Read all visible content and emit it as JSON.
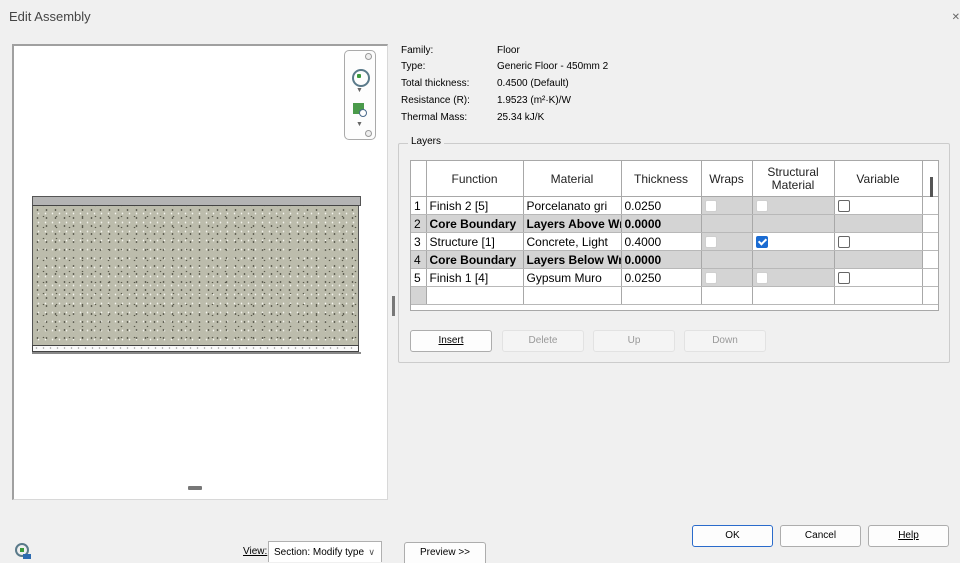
{
  "window": {
    "title": "Edit Assembly"
  },
  "properties": [
    {
      "label": "Family:",
      "value": "Floor"
    },
    {
      "label": "Type:",
      "value": "Generic Floor - 450mm 2"
    },
    {
      "label": "Total thickness:",
      "value": "0.4500 (Default)"
    },
    {
      "label": "Resistance (R):",
      "value": "1.9523 (m²·K)/W"
    },
    {
      "label": "Thermal Mass:",
      "value": "25.34 kJ/K"
    }
  ],
  "layers": {
    "legend": "Layers",
    "columns": [
      "",
      "Function",
      "Material",
      "Thickness",
      "Wraps",
      "Structural Material",
      "Variable"
    ],
    "rows": [
      {
        "num": "1",
        "function": "Finish 2 [5]",
        "material": "Porcelanato gri",
        "thickness": "0.0250",
        "wraps": false,
        "structural": false,
        "variable": false
      },
      {
        "num": "2",
        "function": "Core Boundary",
        "material": "Layers Above Wr",
        "thickness": "0.0000"
      },
      {
        "num": "3",
        "function": "Structure [1]",
        "material": "Concrete, Light",
        "thickness": "0.4000",
        "wraps": false,
        "structural": true,
        "variable": false
      },
      {
        "num": "4",
        "function": "Core Boundary",
        "material": "Layers Below Wr",
        "thickness": "0.0000"
      },
      {
        "num": "5",
        "function": "Finish 1 [4]",
        "material": "Gypsum Muro",
        "thickness": "0.0250",
        "wraps": false,
        "structural": false,
        "variable": false
      }
    ]
  },
  "buttons": {
    "insert": "Insert",
    "delete": "Delete",
    "up": "Up",
    "down": "Down",
    "ok": "OK",
    "cancel": "Cancel",
    "help": "Help",
    "preview": "Preview >>"
  },
  "view": {
    "label": "View:",
    "value": "Section: Modify type"
  },
  "icons": [
    "steering-wheel-icon",
    "zoom-icon",
    "close-icon",
    "chevron-down-icon"
  ]
}
